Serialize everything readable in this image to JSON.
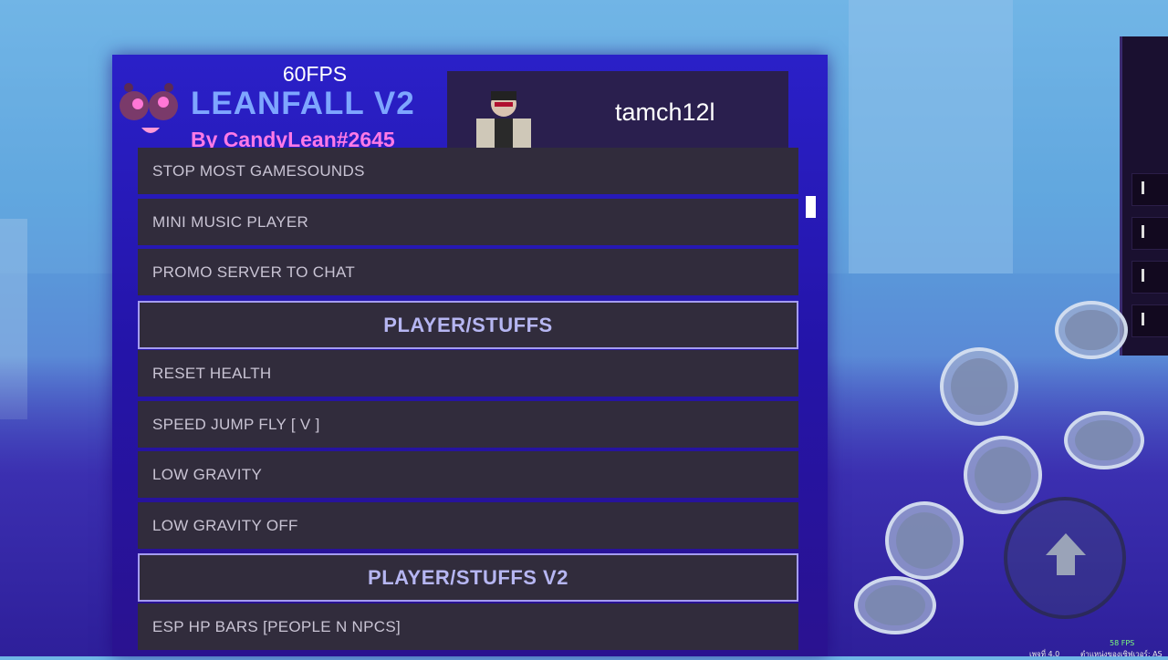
{
  "hub": {
    "fps_label": "60FPS",
    "title": "LEANFALL V2",
    "author": "By CandyLean#2645"
  },
  "profile": {
    "username": "tamch12l"
  },
  "menu": [
    {
      "kind": "item",
      "label": "STOP MOST GAMESOUNDS"
    },
    {
      "kind": "item",
      "label": "MINI MUSIC PLAYER"
    },
    {
      "kind": "item",
      "label": "PROMO SERVER TO CHAT"
    },
    {
      "kind": "section",
      "label": "PLAYER/STUFFS"
    },
    {
      "kind": "item",
      "label": "RESET HEALTH"
    },
    {
      "kind": "item",
      "label": "SPEED JUMP FLY [ V ]"
    },
    {
      "kind": "item",
      "label": "LOW GRAVITY"
    },
    {
      "kind": "item",
      "label": "LOW GRAVITY OFF"
    },
    {
      "kind": "section",
      "label": "PLAYER/STUFFS V2"
    },
    {
      "kind": "item",
      "label": "ESP HP BARS [PEOPLE N NPCS]"
    }
  ],
  "controls": {
    "skill_icons": [
      "sword-slash-icon",
      "blade-icon",
      "dash-icon",
      "shield-icon",
      "gear-skill-icon",
      "ring-skill-icon"
    ],
    "jump_icon": "up-arrow-icon"
  },
  "status": {
    "fps": "58 FPS",
    "version": "เพจที่ 4.0",
    "server": "ตำแหน่งของเซิฟเวอร์: AS"
  },
  "colors": {
    "panel": "#2a20c8",
    "item_bg": "#312c3c",
    "title": "#7ea6ff",
    "author": "#ff7ae6",
    "section_border": "#a49cf0"
  }
}
